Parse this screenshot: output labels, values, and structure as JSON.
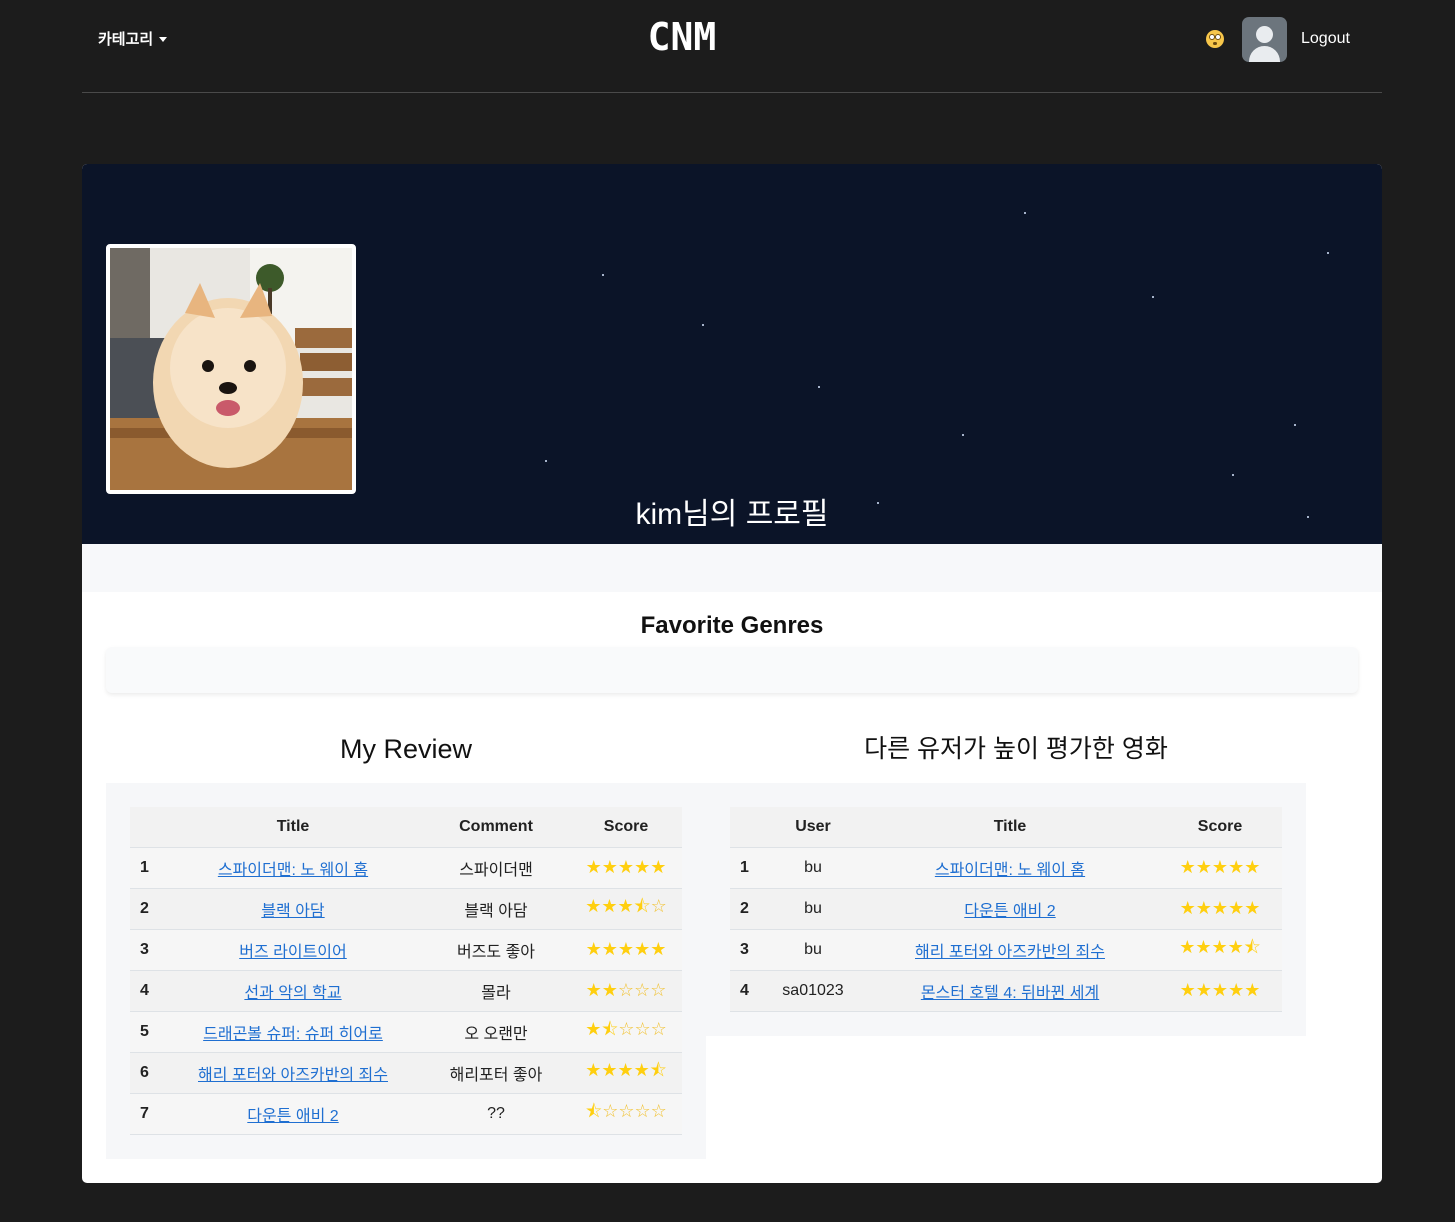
{
  "header": {
    "category_label": "카테고리",
    "logo_text": "CNM",
    "logout_label": "Logout"
  },
  "profile": {
    "title": "kim님의 프로필"
  },
  "favorite_genres": {
    "title": "Favorite Genres"
  },
  "my_review": {
    "title": "My Review",
    "columns": [
      "",
      "Title",
      "Comment",
      "Score"
    ],
    "rows": [
      {
        "no": "1",
        "title": "스파이더맨: 노 웨이 홈",
        "comment": "스파이더맨",
        "score": 5
      },
      {
        "no": "2",
        "title": "블랙 아담",
        "comment": "블랙 아담",
        "score": 3.5
      },
      {
        "no": "3",
        "title": "버즈 라이트이어",
        "comment": "버즈도 좋아",
        "score": 5
      },
      {
        "no": "4",
        "title": "선과 악의 학교",
        "comment": "몰라",
        "score": 2
      },
      {
        "no": "5",
        "title": "드래곤볼 슈퍼: 슈퍼 히어로",
        "comment": "오 오랜만",
        "score": 1.5
      },
      {
        "no": "6",
        "title": "해리 포터와 아즈카반의 죄수",
        "comment": "해리포터 좋아",
        "score": 4.5
      },
      {
        "no": "7",
        "title": "다운튼 애비 2",
        "comment": "??",
        "score": 0.5
      }
    ]
  },
  "others": {
    "title": "다른 유저가 높이 평가한 영화",
    "columns": [
      "",
      "User",
      "Title",
      "Score"
    ],
    "rows": [
      {
        "no": "1",
        "user": "bu",
        "title": "스파이더맨: 노 웨이 홈",
        "score": 5
      },
      {
        "no": "2",
        "user": "bu",
        "title": "다운튼 애비 2",
        "score": 5
      },
      {
        "no": "3",
        "user": "bu",
        "title": "해리 포터와 아즈카반의 죄수",
        "score": 4.5
      },
      {
        "no": "4",
        "user": "sa01023",
        "title": "몬스터 호텔 4: 뒤바뀐 세계",
        "score": 5
      }
    ]
  },
  "colors": {
    "page_bg": "#1c1c1c",
    "banner_bg": "#0b1428",
    "link": "#1f6fd1",
    "star": "#ffcf0f"
  }
}
